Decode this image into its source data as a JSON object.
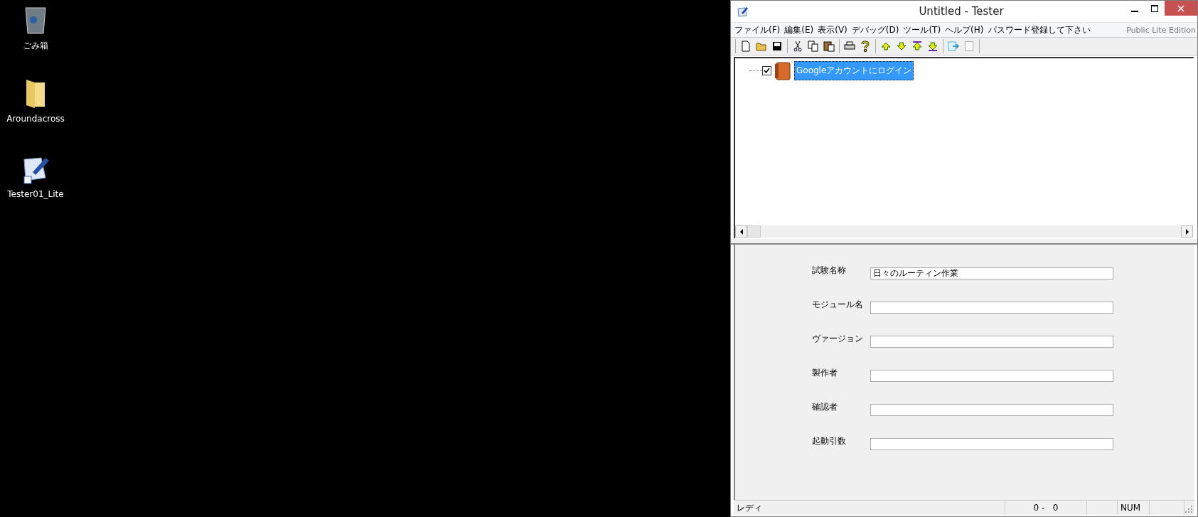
{
  "desktop": {
    "icons": [
      {
        "label": "ごみ箱",
        "kind": "trash"
      },
      {
        "label": "Aroundacross",
        "kind": "folder"
      },
      {
        "label": "Tester01_Lite",
        "kind": "shortcut"
      }
    ]
  },
  "window": {
    "title": "Untitled - Tester"
  },
  "menu": {
    "items": [
      "ファイル(F)",
      "編集(E)",
      "表示(V)",
      "デバッグ(D)",
      "ツール(T)",
      "ヘルプ(H)",
      "パスワード登録して下さい"
    ],
    "edition": "Public Lite Edition"
  },
  "tree": {
    "items": [
      {
        "label": "Googleアカウントにログイン",
        "checked": true,
        "selected": true
      }
    ]
  },
  "form": {
    "fields": [
      {
        "label": "試験名称",
        "value": "日々のルーティン作業"
      },
      {
        "label": "モジュール名"
      },
      {
        "label": "ヴァージョン"
      },
      {
        "label": "製作者"
      },
      {
        "label": "確認者"
      },
      {
        "label": "起動引数"
      }
    ]
  },
  "status_bar": {
    "message": "レディ",
    "position": "0 -   0",
    "num": "NUM"
  }
}
